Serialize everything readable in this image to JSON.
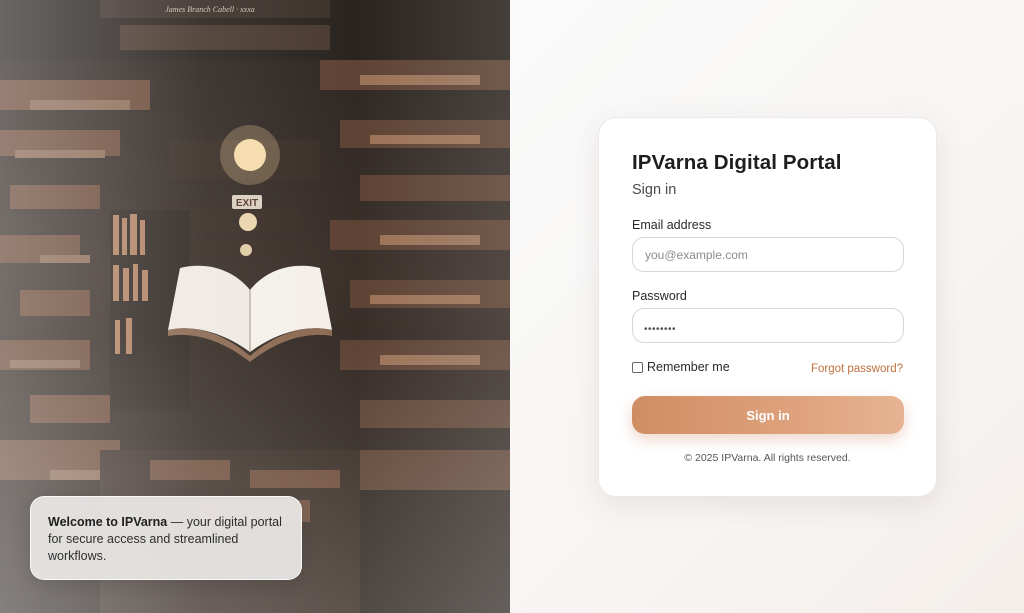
{
  "hero": {
    "image_name": "library-floating-book-image",
    "sign_text": "EXIT",
    "top_book_text": "James Branch Cabell · xxxa"
  },
  "welcome": {
    "brand": "Welcome to IPVarna",
    "message": " — your digital portal for secure access and streamlined workflows."
  },
  "login": {
    "title": "IPVarna Digital Portal",
    "subtitle": "Sign in",
    "email_label": "Email address",
    "email_placeholder": "you@example.com",
    "password_label": "Password",
    "password_value": "••••••••",
    "remember_label": "Remember me",
    "remember_checked": false,
    "forgot_link": "Forgot password?",
    "submit_label": "Sign in",
    "copyright": "© 2025 IPVarna. All rights reserved."
  },
  "colors": {
    "accent": "#cf8d64",
    "accent_light": "#e6b392",
    "link": "#c0703e"
  }
}
